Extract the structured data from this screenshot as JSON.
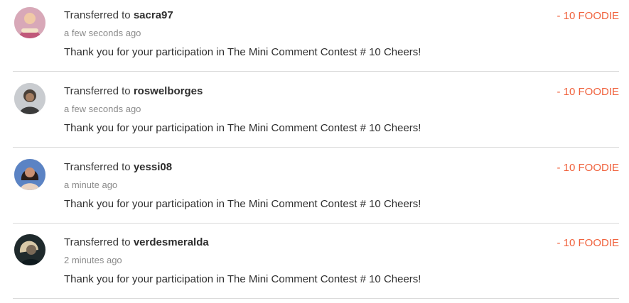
{
  "colors": {
    "amount": "#f0623d",
    "title": "#3a3a3a",
    "timestamp": "#8a8a8a",
    "divider": "#d9d9d9"
  },
  "transactions": [
    {
      "prefix": "Transferred to",
      "username": "sacra97",
      "time": "a few seconds ago",
      "message": "Thank you for your participation in The Mini Comment Contest # 10 Cheers!",
      "amount": "- 10 FOODIE",
      "avatar_icon": "user-avatar-icon"
    },
    {
      "prefix": "Transferred to",
      "username": "roswelborges",
      "time": "a few seconds ago",
      "message": "Thank you for your participation in The Mini Comment Contest # 10 Cheers!",
      "amount": "- 10 FOODIE",
      "avatar_icon": "user-avatar-icon"
    },
    {
      "prefix": "Transferred to",
      "username": "yessi08",
      "time": "a minute ago",
      "message": "Thank you for your participation in The Mini Comment Contest # 10 Cheers!",
      "amount": "- 10 FOODIE",
      "avatar_icon": "user-avatar-icon"
    },
    {
      "prefix": "Transferred to",
      "username": "verdesmeralda",
      "time": "2 minutes ago",
      "message": "Thank you for your participation in The Mini Comment Contest # 10 Cheers!",
      "amount": "- 10 FOODIE",
      "avatar_icon": "user-avatar-icon"
    }
  ]
}
